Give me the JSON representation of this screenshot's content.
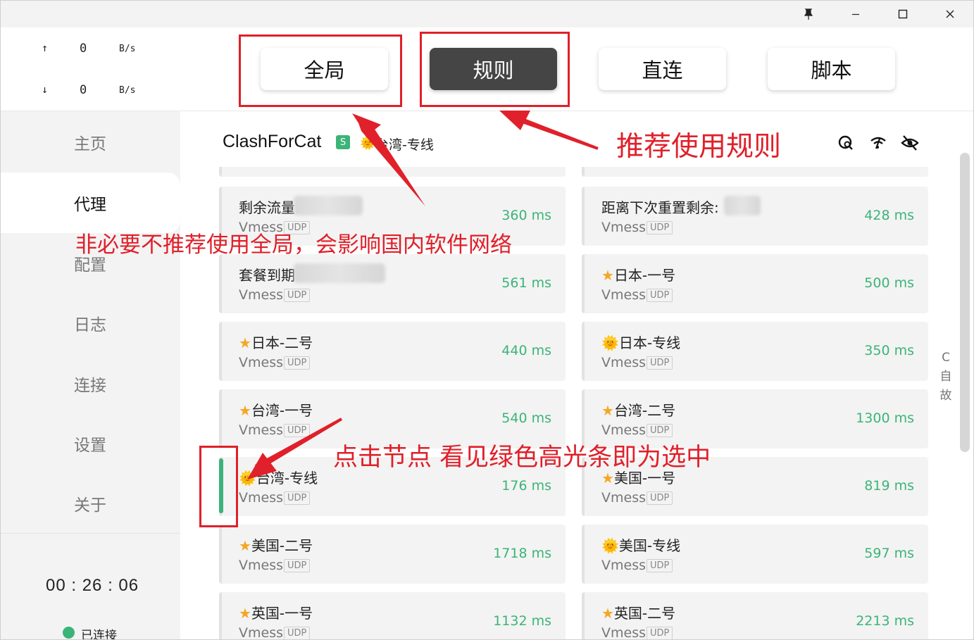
{
  "window": {
    "controls": {
      "pin": "📌",
      "minimize": "—",
      "maximize": "☐",
      "close": "✕"
    }
  },
  "traffic": {
    "up": {
      "arrow": "↑",
      "value": "0",
      "unit": "B/s"
    },
    "down": {
      "arrow": "↓",
      "value": "0",
      "unit": "B/s"
    }
  },
  "nav": {
    "items": [
      {
        "label": "主页"
      },
      {
        "label": "代理"
      },
      {
        "label": "配置"
      },
      {
        "label": "日志"
      },
      {
        "label": "连接"
      },
      {
        "label": "设置"
      },
      {
        "label": "关于"
      }
    ]
  },
  "status": {
    "timer": "00 : 26 : 06",
    "connection": "已连接",
    "dot_color": "#3bb478"
  },
  "modes": {
    "global": "全局",
    "rule": "规则",
    "direct": "直连",
    "script": "脚本",
    "active": "rule"
  },
  "group": {
    "title": "ClashForCat",
    "badge": "S",
    "selected_icon": "🌞",
    "selected": "台湾-专线"
  },
  "proxies": [
    {
      "name": "剩余流量:",
      "type": "Vmess",
      "udp": "UDP",
      "delay": "360 ms",
      "icon": ""
    },
    {
      "name": "距离下次重置剩余:",
      "type": "Vmess",
      "udp": "UDP",
      "delay": "428 ms",
      "icon": ""
    },
    {
      "name": "套餐到期:",
      "type": "Vmess",
      "udp": "UDP",
      "delay": "561 ms",
      "icon": ""
    },
    {
      "name": "日本-一号",
      "type": "Vmess",
      "udp": "UDP",
      "delay": "500 ms",
      "icon": "★"
    },
    {
      "name": "日本-二号",
      "type": "Vmess",
      "udp": "UDP",
      "delay": "440 ms",
      "icon": "★"
    },
    {
      "name": "日本-专线",
      "type": "Vmess",
      "udp": "UDP",
      "delay": "350 ms",
      "icon": "🌞"
    },
    {
      "name": "台湾-一号",
      "type": "Vmess",
      "udp": "UDP",
      "delay": "540 ms",
      "icon": "★"
    },
    {
      "name": "台湾-二号",
      "type": "Vmess",
      "udp": "UDP",
      "delay": "1300 ms",
      "icon": "★"
    },
    {
      "name": "台湾-专线",
      "type": "Vmess",
      "udp": "UDP",
      "delay": "176 ms",
      "icon": "🌞"
    },
    {
      "name": "美国-一号",
      "type": "Vmess",
      "udp": "UDP",
      "delay": "819 ms",
      "icon": "★"
    },
    {
      "name": "美国-二号",
      "type": "Vmess",
      "udp": "UDP",
      "delay": "1718 ms",
      "icon": "★"
    },
    {
      "name": "美国-专线",
      "type": "Vmess",
      "udp": "UDP",
      "delay": "597 ms",
      "icon": "🌞"
    },
    {
      "name": "英国-一号",
      "type": "Vmess",
      "udp": "UDP",
      "delay": "1132 ms",
      "icon": "★"
    },
    {
      "name": "英国-二号",
      "type": "Vmess",
      "udp": "UDP",
      "delay": "2213 ms",
      "icon": "★"
    }
  ],
  "side_tools": [
    "C",
    "自",
    "故"
  ],
  "annotations": {
    "recommend_rule": "推荐使用规则",
    "not_global": "非必要不推荐使用全局，会影响国内软件网络",
    "click_node": "点击节点  看见绿色高光条即为选中"
  },
  "colors": {
    "accent": "#3bb478",
    "annotation": "#e0202a",
    "active_mode": "#454545"
  }
}
